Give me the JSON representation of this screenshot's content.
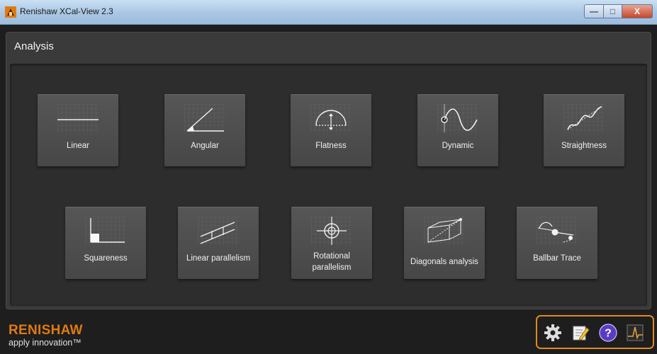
{
  "window": {
    "title": "Renishaw XCal-View 2.3",
    "controls": {
      "minimize": "—",
      "maximize": "□",
      "close": "X"
    }
  },
  "analysis": {
    "title": "Analysis",
    "tiles_row1": [
      {
        "id": "linear",
        "label": "Linear",
        "icon": "linear-graph-icon"
      },
      {
        "id": "angular",
        "label": "Angular",
        "icon": "angle-icon"
      },
      {
        "id": "flatness",
        "label": "Flatness",
        "icon": "flatness-dome-icon"
      },
      {
        "id": "dynamic",
        "label": "Dynamic",
        "icon": "sine-wave-icon"
      },
      {
        "id": "straightness",
        "label": "Straightness",
        "icon": "straightness-wave-icon"
      }
    ],
    "tiles_row2": [
      {
        "id": "squareness",
        "label": "Squareness",
        "icon": "square-corner-icon"
      },
      {
        "id": "linear-parallelism",
        "label": "Linear parallelism",
        "icon": "parallel-lines-icon"
      },
      {
        "id": "rotational-parallelism",
        "label": "Rotational parallelism",
        "icon": "crosshair-target-icon"
      },
      {
        "id": "diagonals-analysis",
        "label": "Diagonals analysis",
        "icon": "diagonal-cube-icon"
      },
      {
        "id": "ballbar-trace",
        "label": "Ballbar Trace",
        "icon": "ballbar-trace-icon"
      }
    ]
  },
  "footer": {
    "brand": "RENISHAW",
    "tagline": "apply innovation™",
    "toolbar": [
      {
        "id": "settings",
        "icon": "gear-icon"
      },
      {
        "id": "notes",
        "icon": "edit-notepad-icon"
      },
      {
        "id": "help",
        "icon": "help-icon"
      },
      {
        "id": "trace",
        "icon": "signal-trace-icon"
      }
    ]
  },
  "colors": {
    "accent": "#e08a1e",
    "brand": "#e07a12",
    "help": "#5a3bc8",
    "tile": "#505050"
  }
}
